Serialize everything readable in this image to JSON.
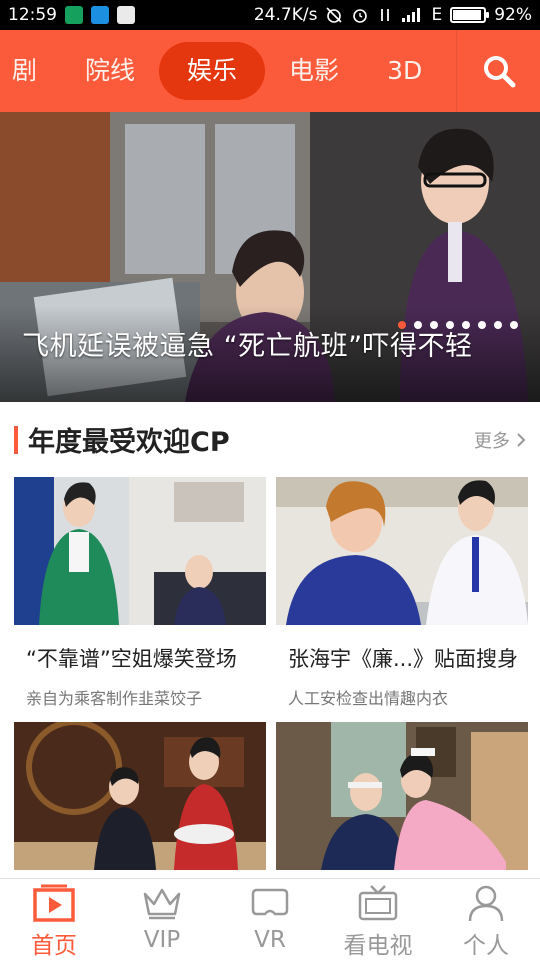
{
  "status_bar": {
    "time": "12:59",
    "network_speed": "24.7K/s",
    "network_type": "E",
    "battery_percent": "92%",
    "battery_level": 0.92
  },
  "top_nav": {
    "tabs": [
      {
        "label": "剧"
      },
      {
        "label": "院线"
      },
      {
        "label": "娱乐"
      },
      {
        "label": "电影"
      },
      {
        "label": "3D"
      }
    ],
    "active_tab": "娱乐"
  },
  "banner": {
    "title": "飞机延误被逼急 “死亡航班”吓得不轻",
    "dot_count": 8,
    "active_dot": 0
  },
  "section": {
    "title": "年度最受欢迎CP",
    "more_label": "更多",
    "cards": [
      {
        "title": "“不靠谱”空姐爆笑登场",
        "subtitle": "亲自为乘客制作韭菜饺子"
      },
      {
        "title": "张海宇《廉...》贴面搜身",
        "subtitle": "人工安检查出情趣内衣"
      },
      {
        "title": "",
        "subtitle": ""
      },
      {
        "title": "",
        "subtitle": ""
      }
    ]
  },
  "bottom_nav": {
    "items": [
      {
        "label": "首页",
        "icon": "home-play-icon"
      },
      {
        "label": "VIP",
        "icon": "crown-icon"
      },
      {
        "label": "VR",
        "icon": "vr-headset-icon"
      },
      {
        "label": "看电视",
        "icon": "tv-icon"
      },
      {
        "label": "个人",
        "icon": "person-icon"
      }
    ],
    "active_item": "首页"
  },
  "colors": {
    "brand": "#fb5b3a",
    "active_pill": "#e4360f",
    "inactive_text": "#999999"
  }
}
